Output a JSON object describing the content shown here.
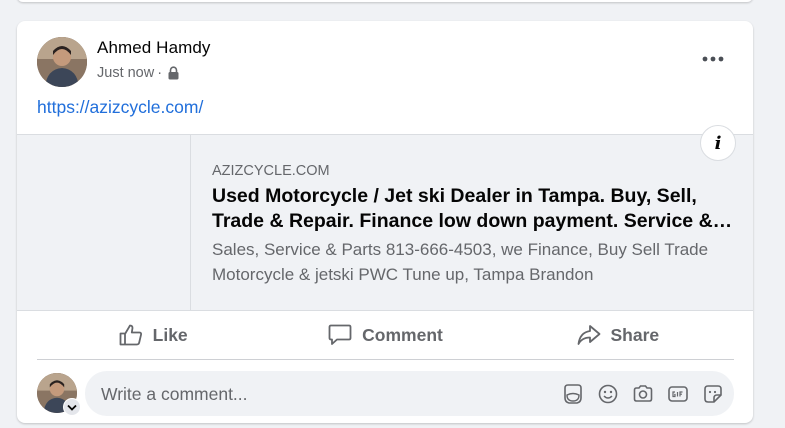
{
  "post": {
    "author": "Ahmed Hamdy",
    "timestamp": "Just now",
    "separator": "·",
    "audience_icon": "lock-icon",
    "link_text": "https://azizcycle.com/"
  },
  "preview": {
    "domain": "AZIZCYCLE.COM",
    "title": "Used Motorcycle / Jet ski Dealer in Tampa. Buy, Sell, Trade & Repair. Finance low down payment. Service & Parts",
    "description": "Sales, Service & Parts 813-666-4503, we Finance, Buy Sell Trade Motorcycle & jetski PWC Tune up, Tampa Brandon",
    "info_label": "i"
  },
  "actions": {
    "like": "Like",
    "comment": "Comment",
    "share": "Share"
  },
  "comment_box": {
    "placeholder": "Write a comment...",
    "icons": [
      "avatar-sticker-icon",
      "emoji-icon",
      "camera-icon",
      "gif-icon",
      "sticker-icon"
    ]
  },
  "colors": {
    "link": "#216fdb",
    "secondary_text": "#65676b",
    "background": "#f0f2f5"
  }
}
